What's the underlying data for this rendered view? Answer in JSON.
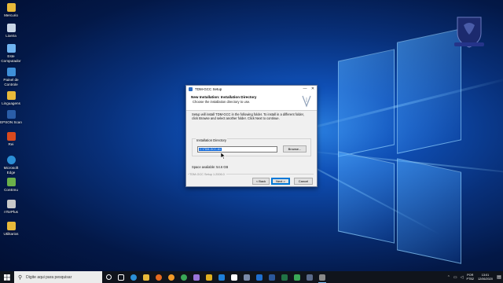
{
  "desktop": {
    "icons": [
      {
        "label": "Mercurio",
        "icon": "folder-icon",
        "color": "#e8b93a"
      },
      {
        "label": "Lixeira",
        "icon": "recycle-bin-icon",
        "color": "#c9d6e6"
      },
      {
        "label": "Este Computador",
        "icon": "computer-icon",
        "color": "#6fb3f0"
      },
      {
        "label": "Painel de Controle",
        "icon": "control-panel-icon",
        "color": "#3e8fd8"
      },
      {
        "label": "Linguagens",
        "icon": "folder-icon",
        "color": "#e8b93a"
      },
      {
        "label": "EPSON Scan",
        "icon": "scanner-icon",
        "color": "#2a5da8"
      },
      {
        "label": "Rei",
        "icon": "app-icon",
        "color": "#d94a1e"
      },
      {
        "label": "Microsoft Edge",
        "icon": "edge-icon",
        "color": "#2b8fd6"
      },
      {
        "label": "ConEmu",
        "icon": "console-icon",
        "color": "#6bb04a"
      },
      {
        "label": "nTorPlus",
        "icon": "app-icon",
        "color": "#c8c8c8"
      },
      {
        "label": "Utilitarios",
        "icon": "folder-icon",
        "color": "#e8b93a"
      }
    ]
  },
  "dialog": {
    "title": "TDM-GCC Setup",
    "minimize": "—",
    "close": "✕",
    "heading": "New Installation: Installation Directory",
    "subheading": "Choose the installation directory to use.",
    "body_text": "Setup will install TDM-GCC in the following folder. To install in a different folder, click Browse and select another folder. Click Next to continue.",
    "group_label": "Installation Directory",
    "path_value": "C:\\TDM-GCC-64",
    "browse_label": "Browse...",
    "space_available": "Space available: 54.6 GB",
    "footer_label": "TDM-GCC Setup 1.2006.0",
    "back_label": "< Back",
    "next_label": "Next >",
    "cancel_label": "Cancel"
  },
  "taskbar": {
    "search_placeholder": "Digite aqui para pesquisar",
    "apps": [
      {
        "icon": "circle-icon",
        "color": "#ffffff"
      },
      {
        "icon": "task-view-icon",
        "color": "#ffffff"
      },
      {
        "icon": "edge-icon",
        "color": "#2b8fd6"
      },
      {
        "icon": "explorer-icon",
        "color": "#e8b93a"
      },
      {
        "icon": "firefox-icon",
        "color": "#e66a1f"
      },
      {
        "icon": "firefox-icon",
        "color": "#f29a28"
      },
      {
        "icon": "chrome-icon",
        "color": "#3aa757"
      },
      {
        "icon": "app-icon",
        "color": "#9a74d8"
      },
      {
        "icon": "app-icon",
        "color": "#e0b020"
      },
      {
        "icon": "store-icon",
        "color": "#1e7fd8"
      },
      {
        "icon": "app-icon",
        "color": "#ffffff"
      },
      {
        "icon": "app-icon",
        "color": "#7a8aa8"
      },
      {
        "icon": "mail-icon",
        "color": "#1f6fcf"
      },
      {
        "icon": "word-icon",
        "color": "#2b579a"
      },
      {
        "icon": "excel-icon",
        "color": "#217346"
      },
      {
        "icon": "app-icon",
        "color": "#3aa757"
      },
      {
        "icon": "app-icon",
        "color": "#5a6a8a"
      },
      {
        "icon": "setup-icon",
        "color": "#8a8a8a"
      }
    ],
    "lang_top": "POR",
    "lang_bottom": "PTB2",
    "time": "13:01",
    "date": "12/06/2020"
  }
}
